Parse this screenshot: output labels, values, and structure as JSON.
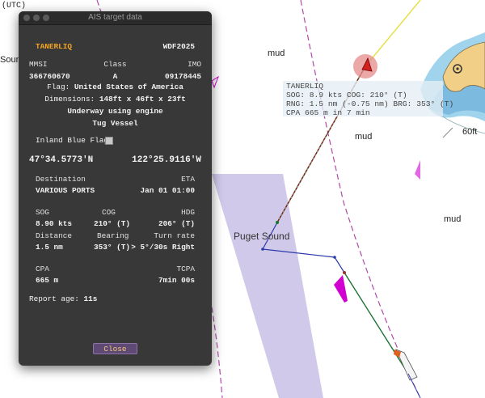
{
  "map": {
    "top_left_label": "(UTC)",
    "sound_label": "Sound",
    "mud_labels": [
      "mud",
      "mud",
      "mud"
    ],
    "puget_sound": "Puget Sound",
    "depth_label": "60ft",
    "colors": {
      "shallow": "#9fd4ec",
      "land": "#f2cf86",
      "lane": "#c9c0e6",
      "own_track": "#2b5aa8",
      "target_track": "#7a1f1f",
      "magenta": "#d000d0"
    }
  },
  "target_label": {
    "name": "TANERLIQ",
    "line1": "SOG: 8.9 kts COG: 210° (T)",
    "line2": "RNG: 1.5 nm (-0.75 nm) BRG: 353° (T)",
    "line3": "CPA 665 m in 7 min"
  },
  "window": {
    "title": "AIS target data",
    "name": "TANERLIQ",
    "callsign": "WDF2025",
    "mmsi_label": "MMSI",
    "class_label": "Class",
    "imo_label": "IMO",
    "mmsi": "366760670",
    "class": "A",
    "imo": "09178445",
    "flag_label": "Flag:",
    "flag": "United States of America",
    "dimensions_label": "Dimensions:",
    "dimensions": "148ft x 46ft x 23ft",
    "nav_status": "Underway using engine",
    "ship_type": "Tug Vessel",
    "inland_flag_label": "Inland Blue Flag",
    "lat": "47°34.5773'N",
    "lon": "122°25.9116'W",
    "destination_label": "Destination",
    "eta_label": "ETA",
    "destination": "VARIOUS PORTS",
    "eta": "Jan 01 01:00",
    "sog_label": "SOG",
    "cog_label": "COG",
    "hdg_label": "HDG",
    "sog": "8.90 kts",
    "cog": "210° (T)",
    "hdg": "206° (T)",
    "distance_label": "Distance",
    "bearing_label": "Bearing",
    "turn_label": "Turn rate",
    "distance": "1.5 nm",
    "bearing": "353° (T)",
    "turn_rate": "> 5°/30s Right",
    "cpa_label": "CPA",
    "tcpa_label": "TCPA",
    "cpa": "665 m",
    "tcpa": "7min 00s",
    "report_age_label": "Report age:",
    "report_age": "11s",
    "close_label": "Close"
  }
}
